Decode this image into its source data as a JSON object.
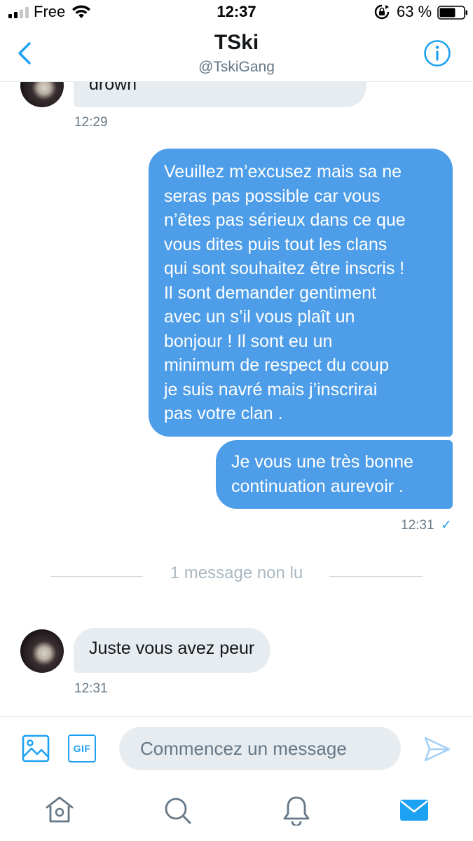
{
  "status_bar": {
    "carrier": "Free",
    "time": "12:37",
    "battery": "63 %"
  },
  "header": {
    "name": "TSki",
    "handle": "@TskiGang"
  },
  "messages": [
    {
      "direction": "in",
      "text": "drown",
      "time": "12:29"
    },
    {
      "direction": "out",
      "lines": [
        "Veuillez m’excusez mais sa ne",
        "seras pas possible car vous",
        "n’êtes pas sérieux dans ce que",
        "vous dites puis tout les clans",
        "qui sont souhaitez être inscris !",
        "Il sont demander gentiment",
        "avec un s’il vous plaît un",
        "bonjour ! Il sont eu un",
        "minimum de respect du coup",
        "je suis navré mais j’inscrirai",
        "pas votre clan ."
      ]
    },
    {
      "direction": "out",
      "lines": [
        "Je vous une très bonne",
        "continuation aurevoir ."
      ],
      "time": "12:31",
      "read_mark": "✓"
    },
    {
      "direction": "in",
      "text": "Juste vous avez peur",
      "time": "12:31"
    }
  ],
  "unread_divider": "1 message non lu",
  "composer": {
    "placeholder": "Commencez un message",
    "gif_label": "GIF"
  },
  "colors": {
    "accent": "#1da1f2",
    "bubble_out": "#4d9de8",
    "bubble_in": "#e6ecf0",
    "muted_text": "#657786"
  },
  "icons": {
    "back": "chevron-left-icon",
    "info": "info-icon",
    "image": "image-icon",
    "gif": "gif-icon",
    "send": "send-icon",
    "home": "home-icon",
    "search": "search-icon",
    "notifications": "bell-icon",
    "messages": "envelope-icon"
  }
}
